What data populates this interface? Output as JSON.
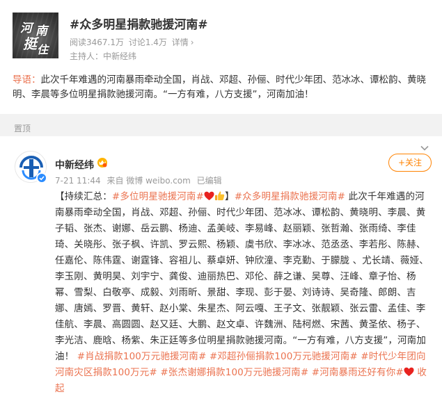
{
  "topic": {
    "title": "#众多明星捐款驰援河南#",
    "reads": "阅读3467.1万",
    "discussions": "讨论1.4万",
    "details_link": "详情",
    "details_chevron": "›",
    "host": "主持人：中新经纬",
    "cover_text": [
      "河",
      "南",
      "挺",
      "住"
    ]
  },
  "guide": {
    "label": "导语：",
    "text": "此次千年难遇的河南暴雨牵动全国，肖战、邓超、孙俪、时代少年团、范冰冰、谭松韵、黄晓明、李晨等多位明星捐款驰援河南。“一方有难，八方支援”，河南加油！"
  },
  "section": {
    "label": "置顶"
  },
  "post": {
    "author": "中新经纬",
    "time": "7-21 11:44",
    "source": "来自 微博 weibo.com",
    "edited": "已编辑",
    "follow_label": "+关注",
    "prefix": "【持续汇总：",
    "tag1": "#多位明星驰援河南#",
    "bracket_close": "】",
    "tag2": "#众多明星捐款驰援河南#",
    "body": " 此次千年难遇的河南暴雨牵动全国，肖战、邓超、孙俪、时代少年团、范冰冰、谭松韵、黄晓明、李晨、黄子韬、张杰、谢娜、岳云鹏、杨迪、孟美岐、李易峰、赵丽颖、张哲瀚、张雨绮、李佳琦、关晓彤、张子枫、许凯、罗云熙、杨颖、虞书欣、李冰冰、范丞丞、李若彤、陈赫、任嘉伦、陈伟霆、谢霆锋、容祖儿、蔡卓妍、钟欣潼、李克勤、于朦胧 、尤长靖、薇娅、李玉刚、黄明昊、刘宇宁、龚俊、迪丽热巴、邓伦、薛之谦、吴尊、汪峰、章子怡、杨幂、雪梨、白敬亭、成毅、刘雨昕、景甜、李现、彭于晏、刘诗诗、吴奇隆、郎朗、吉娜、唐嫣、罗晋、黄轩、赵小棠、朱星杰、阿云嘎、王子文、张靓颖、张云雷、孟佳、李佳航、李晨、高圆圆、赵又廷、大鹏、赵文卓、许魏洲、陆柯燃、宋茜、黄圣依、杨子、李光洁、鹿晗、杨紫、朱正廷等多位明星捐款驰援河南。“一方有难，八方支援”，河南加油！",
    "tag3": "#肖战捐款100万元驰援河南#",
    "tag4": "#邓超孙俪捐款100万元驰援河南#",
    "tag5": "#时代少年团向河南灾区捐款100万元#",
    "tag6": "#张杰谢娜捐款100万元驰援河南#",
    "tag7": "#河南暴雨还好有你#",
    "collapse": "收起"
  },
  "colors": {
    "accent": "#eb7350",
    "follow": "#ff8200",
    "muted": "#999999",
    "verified_blue": "#2b8cff"
  },
  "icons": {
    "chevron": "chevron-down-icon",
    "verified": "verified-badge-icon",
    "vip": "vip-icon",
    "heart": "red-heart-icon",
    "thumb": "thumbs-up-icon"
  }
}
